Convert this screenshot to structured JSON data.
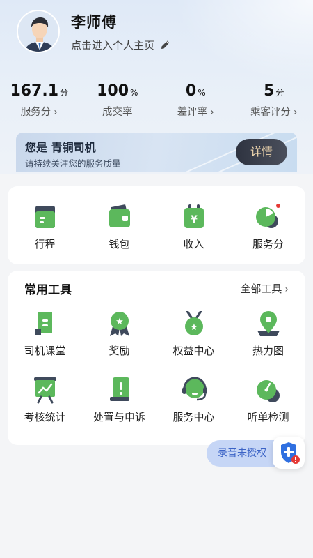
{
  "profile": {
    "name": "李师傅",
    "link_label": "点击进入个人主页"
  },
  "stats": [
    {
      "value": "167.1",
      "unit": "分",
      "label": "服务分",
      "has_arrow": true
    },
    {
      "value": "100",
      "unit": "%",
      "label": "成交率",
      "has_arrow": false
    },
    {
      "value": "0",
      "unit": "%",
      "label": "差评率",
      "has_arrow": true
    },
    {
      "value": "5",
      "unit": "分",
      "label": "乘客评分",
      "has_arrow": true
    }
  ],
  "level_banner": {
    "prefix": "您是",
    "level": "青铜司机",
    "subtitle": "请持续关注您的服务质量",
    "button": "详情"
  },
  "quick_entries": [
    {
      "label": "行程",
      "icon": "itinerary-icon"
    },
    {
      "label": "钱包",
      "icon": "wallet-icon"
    },
    {
      "label": "收入",
      "icon": "income-icon"
    },
    {
      "label": "服务分",
      "icon": "service-score-icon"
    }
  ],
  "tools": {
    "title": "常用工具",
    "all_label": "全部工具",
    "items": [
      {
        "label": "司机课堂",
        "icon": "driver-class-icon"
      },
      {
        "label": "奖励",
        "icon": "reward-icon"
      },
      {
        "label": "权益中心",
        "icon": "benefits-icon"
      },
      {
        "label": "热力图",
        "icon": "heatmap-icon"
      },
      {
        "label": "考核统计",
        "icon": "assessment-stats-icon"
      },
      {
        "label": "处置与申诉",
        "icon": "appeal-icon"
      },
      {
        "label": "服务中心",
        "icon": "service-center-icon"
      },
      {
        "label": "听单检测",
        "icon": "order-detection-icon"
      }
    ]
  },
  "floating": {
    "recording_label": "录音未授权",
    "shield_icon": "shield-alert-icon"
  },
  "colors": {
    "accent_green": "#4caf50",
    "icon_dark": "#3f4a5c",
    "pill_bg": "#c6d6f6",
    "pill_text": "#3b63c6",
    "alert_red": "#e53935"
  }
}
